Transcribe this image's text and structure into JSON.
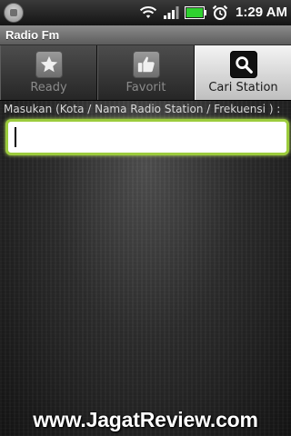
{
  "status_bar": {
    "time": "1:29 AM",
    "icons": [
      "wifi-icon",
      "signal-icon",
      "battery-icon",
      "alarm-icon"
    ]
  },
  "app": {
    "title": "Radio Fm"
  },
  "tabs": [
    {
      "label": "Ready",
      "icon": "star-icon",
      "active": false
    },
    {
      "label": "Favorit",
      "icon": "thumbs-up-icon",
      "active": false
    },
    {
      "label": "Cari Station",
      "icon": "search-icon",
      "active": true
    }
  ],
  "search": {
    "label": "Masukan (Kota / Nama Radio Station / Frekuensi ) :",
    "value": "",
    "placeholder": ""
  },
  "watermark": "www.JagatReview.com",
  "colors": {
    "input_focus_border": "#9ccc3c",
    "active_tab": "#e6e6e6",
    "inactive_tab": "#3a3a3a"
  }
}
